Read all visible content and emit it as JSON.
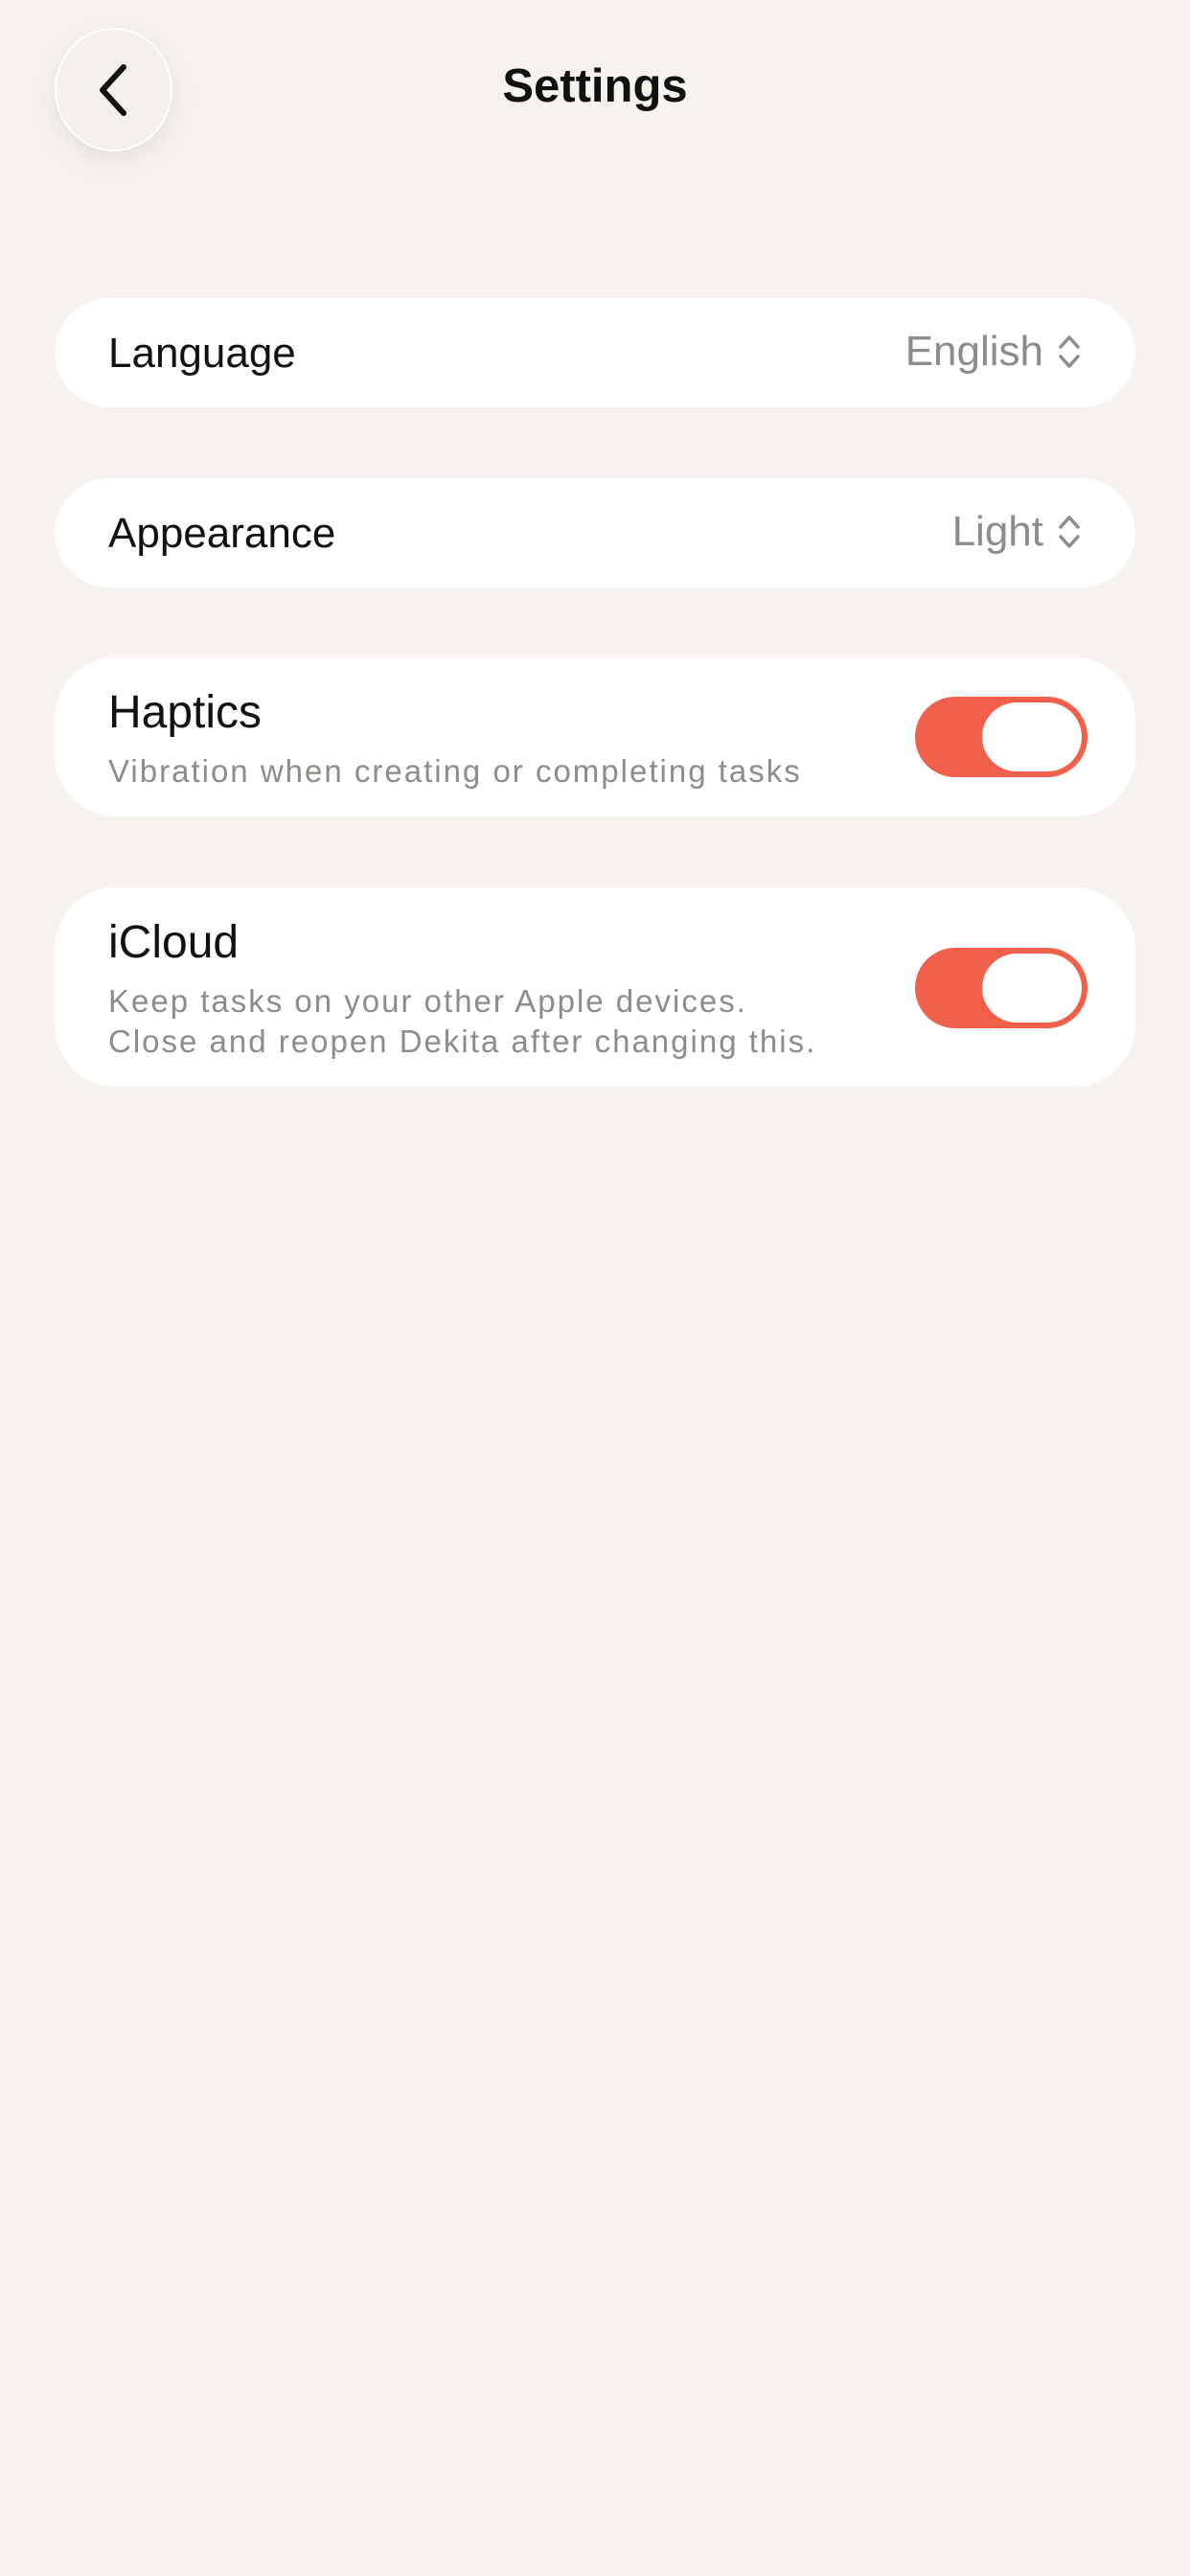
{
  "header": {
    "title": "Settings",
    "back_icon": "chevron-left-icon"
  },
  "settings": {
    "language": {
      "label": "Language",
      "value": "English",
      "icon": "chevron-up-down-icon"
    },
    "appearance": {
      "label": "Appearance",
      "value": "Light",
      "icon": "chevron-up-down-icon"
    },
    "haptics": {
      "title": "Haptics",
      "description": "Vibration when creating or completing tasks",
      "enabled": true
    },
    "icloud": {
      "title": "iCloud",
      "description_line1": "Keep tasks on your other Apple devices.",
      "description_line2": "Close and reopen Dekita after changing this.",
      "enabled": true
    }
  },
  "colors": {
    "background": "#f6f3ee",
    "card": "#ffffff",
    "toggle_on": "#f0604a",
    "secondary_text": "#8e8c88"
  }
}
